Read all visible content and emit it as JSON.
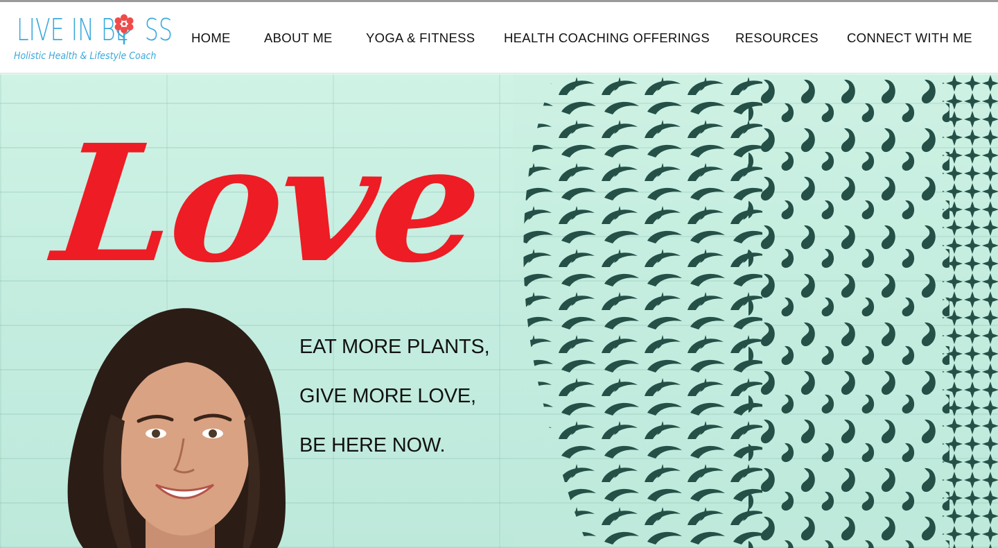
{
  "logo": {
    "wordmark_part1": "LIVE IN BL",
    "wordmark_part2": "SS",
    "tagline": "Holistic Health & Lifestyle Coach",
    "flower_icon": "flower-icon"
  },
  "nav": {
    "items": [
      {
        "label": "HOME"
      },
      {
        "label": "ABOUT ME"
      },
      {
        "label": "YOGA & FITNESS"
      },
      {
        "label": "HEALTH COACHING OFFERINGS"
      },
      {
        "label": "RESOURCES"
      },
      {
        "label": "CONNECT WITH ME"
      }
    ]
  },
  "hero": {
    "script_word": "Love",
    "slogans": [
      "EAT MORE PLANTS,",
      "GIVE MORE LOVE,",
      "BE HERE NOW."
    ]
  },
  "colors": {
    "brand_blue": "#3ba9dc",
    "accent_red": "#ee1c24",
    "wall_mint": "#c7eee0",
    "pattern_dark": "#0f3b33"
  }
}
